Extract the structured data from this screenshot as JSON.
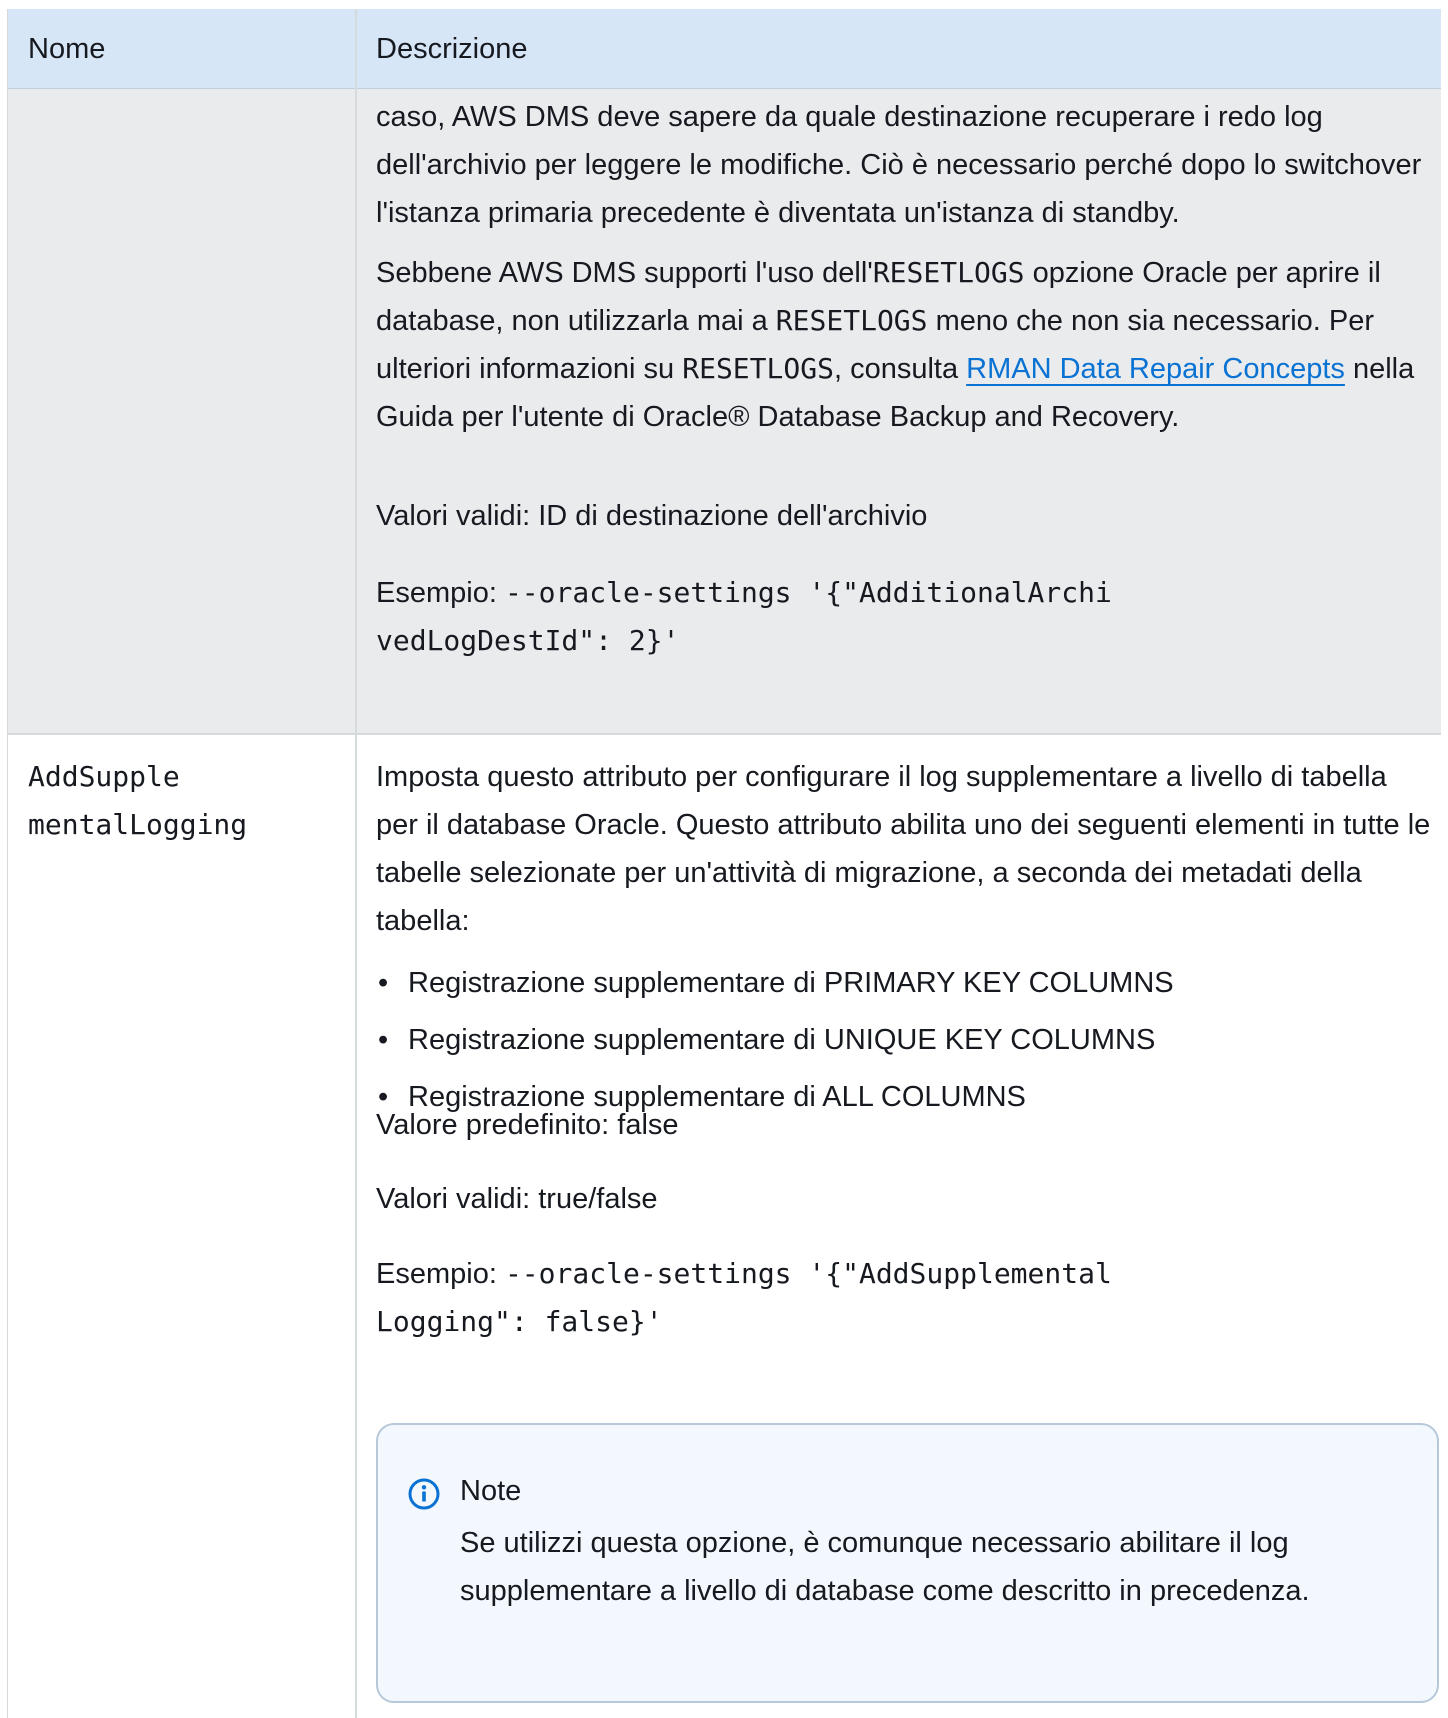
{
  "table": {
    "header": {
      "name": "Nome",
      "description": "Descrizione"
    },
    "row1": {
      "para1": "caso, AWS DMS deve sapere da quale destinazione recuperare i redo log dell'archivio per leggere le modifiche. Ciò è necessario perché dopo lo switchover l'istanza primaria precedente è diventata un'istanza di standby.",
      "para2": {
        "t1": "Sebbene AWS DMS supporti l'uso dell'",
        "code1": "RESETLOGS",
        "t2": " opzione Oracle per aprire il database, non utilizzarla mai a ",
        "code2": "RESETLOGS",
        "t3": " meno che non sia necessario. Per ulteriori informazioni su ",
        "code3": "RESETLOGS",
        "t4": ", consulta ",
        "link": "RMAN Data Repair Concepts",
        "t5": " nella Guida per l'utente di Oracle® Database Backup and Recovery."
      },
      "valid_values": "Valori validi: ID di destinazione dell'archivio",
      "example_label": "Esempio: ",
      "example_code_line1": "--oracle-settings '{\"AdditionalArchi",
      "example_code_line2": "vedLogDestId\": 2}'"
    },
    "row2": {
      "name_line1": "AddSupple",
      "name_line2": "mentalLogging",
      "intro": "Imposta questo attributo per configurare il log supplementare a livello di tabella per il database Oracle. Questo attributo abilita uno dei seguenti elementi in tutte le tabelle selezionate per un'attività di migrazione, a seconda dei metadati della tabella:",
      "bullets": [
        "Registrazione supplementare di PRIMARY KEY COLUMNS",
        "Registrazione supplementare di UNIQUE KEY COLUMNS",
        "Registrazione supplementare di ALL COLUMNS"
      ],
      "default_value": "Valore predefinito: false",
      "valid_values": "Valori validi: true/false",
      "example_label": "Esempio: ",
      "example_code_line1": "--oracle-settings '{\"AddSupplemental",
      "example_code_line2": "Logging\": false}'",
      "note": {
        "icon": "info-icon",
        "title": "Note",
        "body": "Se utilizzi questa opzione, è comunque necessario abilitare il log supplementare a livello di database come descritto in precedenza."
      }
    }
  },
  "colors": {
    "header_bg": "#d6e6f6",
    "row1_bg": "#e9ebed",
    "link": "#0972d3",
    "note_bg": "#f2f8fd",
    "note_border": "#b6c8da"
  }
}
